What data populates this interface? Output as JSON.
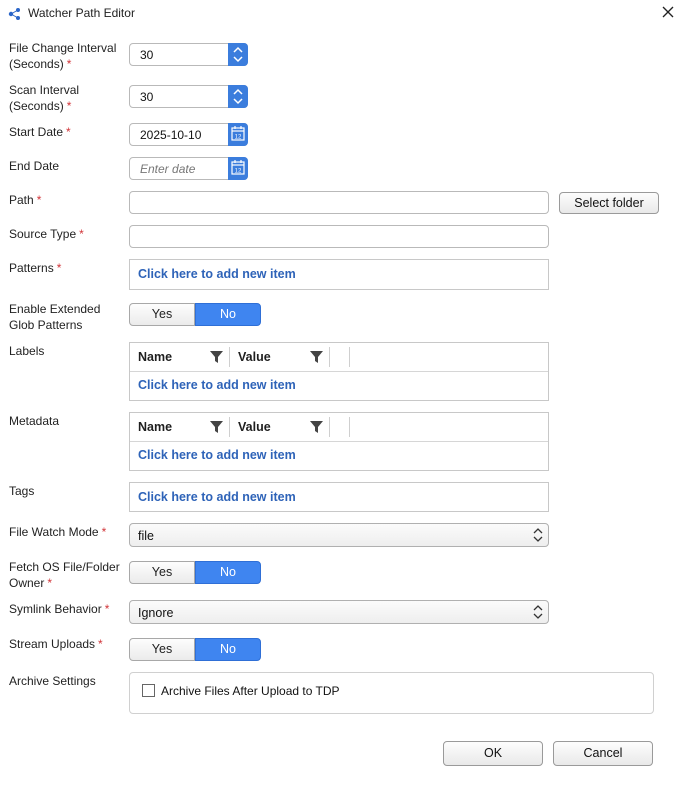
{
  "window": {
    "title": "Watcher Path Editor"
  },
  "fields": {
    "file_change_interval": {
      "label_line1": "File Change Interval",
      "label_line2": "(Seconds)",
      "required": "*",
      "value": "30"
    },
    "scan_interval": {
      "label_line1": "Scan Interval",
      "label_line2": "(Seconds)",
      "required": "*",
      "value": "30"
    },
    "start_date": {
      "label": "Start Date",
      "required": "*",
      "value": "2025-10-10"
    },
    "end_date": {
      "label": "End Date",
      "placeholder": "Enter date"
    },
    "path": {
      "label": "Path",
      "required": "*",
      "value": "",
      "select_folder_label": "Select folder"
    },
    "source_type": {
      "label": "Source Type",
      "required": "*",
      "value": ""
    },
    "patterns": {
      "label": "Patterns",
      "required": "*",
      "add_item": "Click here to add new item"
    },
    "extended_glob": {
      "label_line1": "Enable Extended",
      "label_line2": "Glob Patterns",
      "yes": "Yes",
      "no": "No",
      "selected": "No"
    },
    "labels": {
      "label": "Labels",
      "col_name": "Name",
      "col_value": "Value",
      "add_item": "Click here to add new item"
    },
    "metadata": {
      "label": "Metadata",
      "col_name": "Name",
      "col_value": "Value",
      "add_item": "Click here to add new item"
    },
    "tags": {
      "label": "Tags",
      "add_item": "Click here to add new item"
    },
    "file_watch_mode": {
      "label": "File Watch Mode",
      "required": "*",
      "value": "file"
    },
    "fetch_owner": {
      "label_line1": "Fetch OS File/Folder",
      "label_line2": "Owner",
      "required": "*",
      "yes": "Yes",
      "no": "No",
      "selected": "No"
    },
    "symlink_behavior": {
      "label": "Symlink Behavior",
      "required": "*",
      "value": "Ignore"
    },
    "stream_uploads": {
      "label": "Stream Uploads",
      "required": "*",
      "yes": "Yes",
      "no": "No",
      "selected": "No"
    },
    "archive_settings": {
      "label": "Archive Settings",
      "checkbox_label": "Archive Files After Upload to TDP",
      "checked": false
    }
  },
  "footer": {
    "ok_label": "OK",
    "cancel_label": "Cancel"
  },
  "colors": {
    "accent": "#3f85f0",
    "link": "#2e63b8",
    "required": "#d13438"
  }
}
